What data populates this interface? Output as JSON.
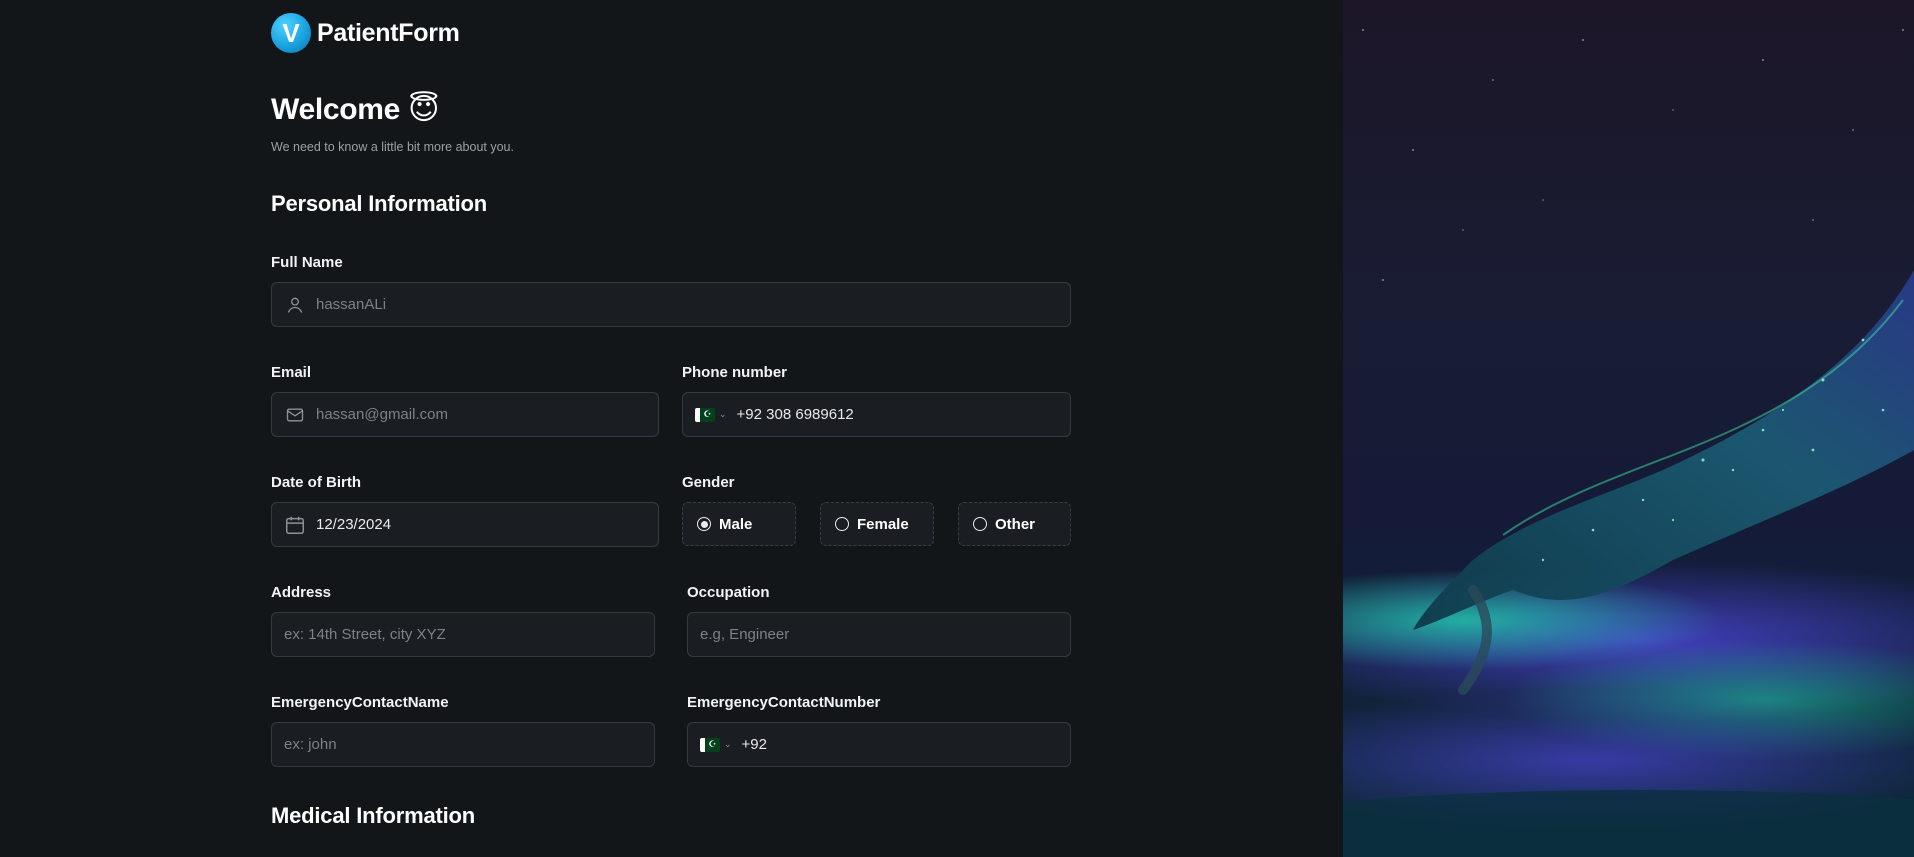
{
  "brand": {
    "logo_letter": "V",
    "name": "PatientForm",
    "accent": "#24ade5"
  },
  "header": {
    "title": "Welcome 😇",
    "subtitle": "We need to know a little bit more about you."
  },
  "sections": {
    "personal": "Personal Information",
    "medical": "Medical Information"
  },
  "fields": {
    "full_name": {
      "label": "Full Name",
      "value": "hassanALi",
      "icon": "user-icon"
    },
    "email": {
      "label": "Email",
      "value": "hassan@gmail.com",
      "icon": "mail-icon"
    },
    "phone": {
      "label": "Phone number",
      "value": "+92 308 6989612",
      "country": "PK"
    },
    "dob": {
      "label": "Date of Birth",
      "value": "12/23/2024",
      "icon": "calendar-icon"
    },
    "gender": {
      "label": "Gender",
      "options": [
        "Male",
        "Female",
        "Other"
      ],
      "selected": "Male"
    },
    "address": {
      "label": "Address",
      "placeholder": "ex: 14th Street, city XYZ"
    },
    "occupation": {
      "label": "Occupation",
      "placeholder": "e.g, Engineer"
    },
    "emergency_name": {
      "label": "EmergencyContactName",
      "placeholder": "ex: john"
    },
    "emergency_number": {
      "label": "EmergencyContactNumber",
      "value": "+92",
      "country": "PK"
    }
  }
}
